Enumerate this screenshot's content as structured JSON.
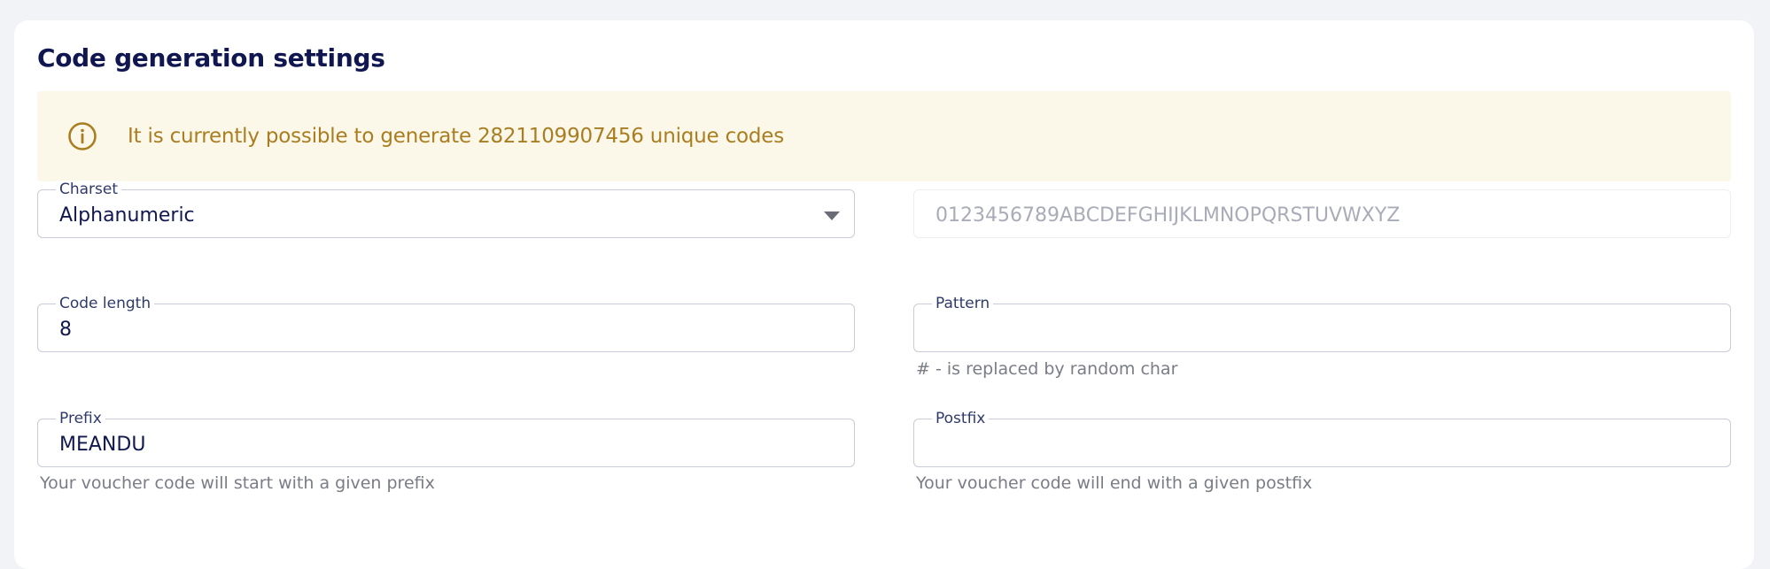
{
  "section": {
    "title": "Code generation settings"
  },
  "alert": {
    "icon": "info-icon",
    "message": "It is currently possible to generate 2821109907456 unique codes"
  },
  "fields": {
    "charset": {
      "label": "Charset",
      "value": "Alphanumeric"
    },
    "charset_preview": {
      "value": "0123456789ABCDEFGHIJKLMNOPQRSTUVWXYZ"
    },
    "code_length": {
      "label": "Code length",
      "value": "8"
    },
    "pattern": {
      "label": "Pattern",
      "value": "",
      "helper": "# - is replaced by random char"
    },
    "prefix": {
      "label": "Prefix",
      "value": "MEANDU",
      "helper": "Your voucher code will start with a given prefix"
    },
    "postfix": {
      "label": "Postfix",
      "value": "",
      "helper": "Your voucher code will end with a given postfix"
    }
  },
  "colors": {
    "title": "#0f1650",
    "alert_bg": "#fcf8e9",
    "alert_text": "#a97d20",
    "field_border": "#c9cbd8"
  }
}
